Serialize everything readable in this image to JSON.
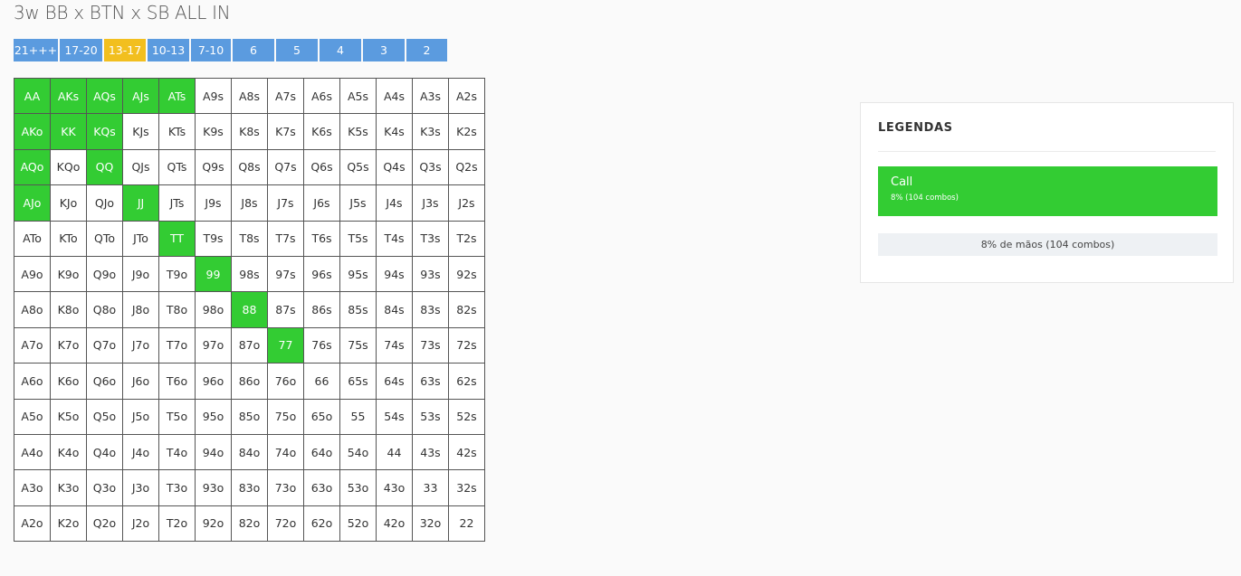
{
  "header": {
    "title": "3w BB x BTN x SB ALL IN"
  },
  "stack_tabs": [
    {
      "label": "21+++",
      "active": false
    },
    {
      "label": "17-20",
      "active": false
    },
    {
      "label": "13-17",
      "active": true
    },
    {
      "label": "10-13",
      "active": false
    },
    {
      "label": "7-10",
      "active": false
    },
    {
      "label": "6",
      "active": false
    },
    {
      "label": "5",
      "active": false
    },
    {
      "label": "4",
      "active": false
    },
    {
      "label": "3",
      "active": false
    },
    {
      "label": "2",
      "active": false
    }
  ],
  "colors": {
    "call": "#33cc33",
    "tab": "#5b9bdf",
    "tab_active": "#f2bf1f"
  },
  "grid": {
    "rows": [
      [
        "AA",
        "AKs",
        "AQs",
        "AJs",
        "ATs",
        "A9s",
        "A8s",
        "A7s",
        "A6s",
        "A5s",
        "A4s",
        "A3s",
        "A2s"
      ],
      [
        "AKo",
        "KK",
        "KQs",
        "KJs",
        "KTs",
        "K9s",
        "K8s",
        "K7s",
        "K6s",
        "K5s",
        "K4s",
        "K3s",
        "K2s"
      ],
      [
        "AQo",
        "KQo",
        "QQ",
        "QJs",
        "QTs",
        "Q9s",
        "Q8s",
        "Q7s",
        "Q6s",
        "Q5s",
        "Q4s",
        "Q3s",
        "Q2s"
      ],
      [
        "AJo",
        "KJo",
        "QJo",
        "JJ",
        "JTs",
        "J9s",
        "J8s",
        "J7s",
        "J6s",
        "J5s",
        "J4s",
        "J3s",
        "J2s"
      ],
      [
        "ATo",
        "KTo",
        "QTo",
        "JTo",
        "TT",
        "T9s",
        "T8s",
        "T7s",
        "T6s",
        "T5s",
        "T4s",
        "T3s",
        "T2s"
      ],
      [
        "A9o",
        "K9o",
        "Q9o",
        "J9o",
        "T9o",
        "99",
        "98s",
        "97s",
        "96s",
        "95s",
        "94s",
        "93s",
        "92s"
      ],
      [
        "A8o",
        "K8o",
        "Q8o",
        "J8o",
        "T8o",
        "98o",
        "88",
        "87s",
        "86s",
        "85s",
        "84s",
        "83s",
        "82s"
      ],
      [
        "A7o",
        "K7o",
        "Q7o",
        "J7o",
        "T7o",
        "97o",
        "87o",
        "77",
        "76s",
        "75s",
        "74s",
        "73s",
        "72s"
      ],
      [
        "A6o",
        "K6o",
        "Q6o",
        "J6o",
        "T6o",
        "96o",
        "86o",
        "76o",
        "66",
        "65s",
        "64s",
        "63s",
        "62s"
      ],
      [
        "A5o",
        "K5o",
        "Q5o",
        "J5o",
        "T5o",
        "95o",
        "85o",
        "75o",
        "65o",
        "55",
        "54s",
        "53s",
        "52s"
      ],
      [
        "A4o",
        "K4o",
        "Q4o",
        "J4o",
        "T4o",
        "94o",
        "84o",
        "74o",
        "64o",
        "54o",
        "44",
        "43s",
        "42s"
      ],
      [
        "A3o",
        "K3o",
        "Q3o",
        "J3o",
        "T3o",
        "93o",
        "83o",
        "73o",
        "63o",
        "53o",
        "43o",
        "33",
        "32s"
      ],
      [
        "A2o",
        "K2o",
        "Q2o",
        "J2o",
        "T2o",
        "92o",
        "82o",
        "72o",
        "62o",
        "52o",
        "42o",
        "32o",
        "22"
      ]
    ],
    "call_hands": [
      "AA",
      "AKs",
      "AQs",
      "AJs",
      "ATs",
      "AKo",
      "KK",
      "KQs",
      "AQo",
      "QQ",
      "AJo",
      "JJ",
      "TT",
      "99",
      "88",
      "77"
    ]
  },
  "legend": {
    "title": "LEGENDAS",
    "items": [
      {
        "label": "Call",
        "detail": "8% (104 combos)"
      }
    ],
    "summary": "8% de mãos (104 combos)"
  }
}
